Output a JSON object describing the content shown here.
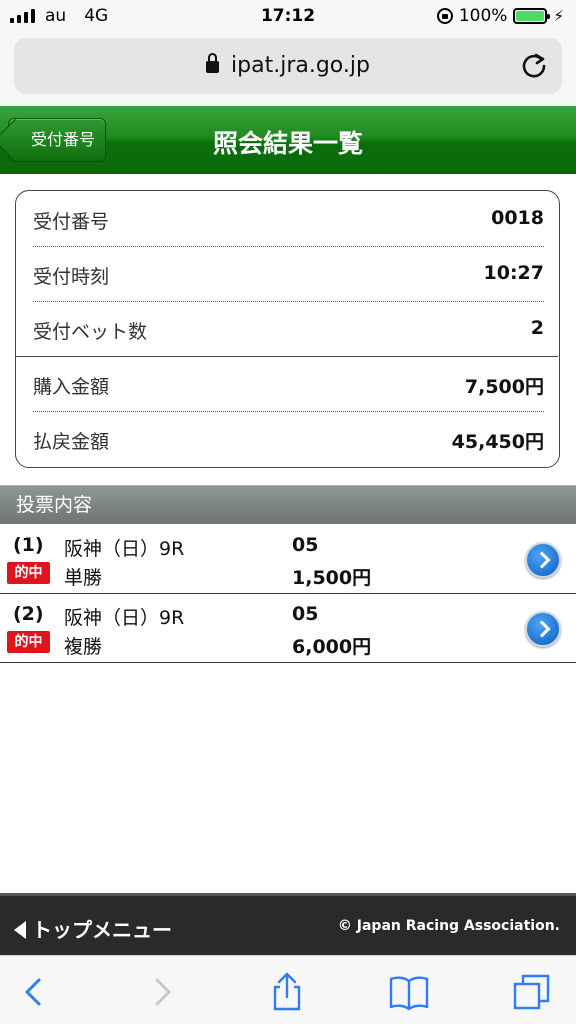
{
  "status_bar": {
    "carrier": "au",
    "network": "4G",
    "time": "17:12",
    "battery": "100%"
  },
  "browser": {
    "url": "ipat.jra.go.jp"
  },
  "header": {
    "back_label": "受付番号",
    "title": "照会結果一覧"
  },
  "summary": [
    {
      "label": "受付番号",
      "value": "0018"
    },
    {
      "label": "受付時刻",
      "value": "10:27"
    },
    {
      "label": "受付ベット数",
      "value": "2"
    },
    {
      "label": "購入金額",
      "value": "7,500円"
    },
    {
      "label": "払戻金額",
      "value": "45,450円"
    }
  ],
  "section_title": "投票内容",
  "bets": [
    {
      "num": "(1)",
      "venue": "阪神（日）9R",
      "horse": "05",
      "badge": "的中",
      "type": "単勝",
      "amount": "1,500円"
    },
    {
      "num": "(2)",
      "venue": "阪神（日）9R",
      "horse": "05",
      "badge": "的中",
      "type": "複勝",
      "amount": "6,000円"
    }
  ],
  "footer": {
    "top_menu": "トップメニュー",
    "copyright": "© Japan Racing Association."
  },
  "colors": {
    "header_green": "#1f8a1f",
    "hit_badge": "#e0141e",
    "ios_blue": "#2f7cf6"
  },
  "icons": [
    "signal-icon",
    "lock-rotation-icon",
    "battery-icon",
    "padlock-icon",
    "reload-icon",
    "chevron-right-circle-icon",
    "back-icon",
    "forward-icon",
    "share-icon",
    "bookmarks-icon",
    "tabs-icon"
  ]
}
